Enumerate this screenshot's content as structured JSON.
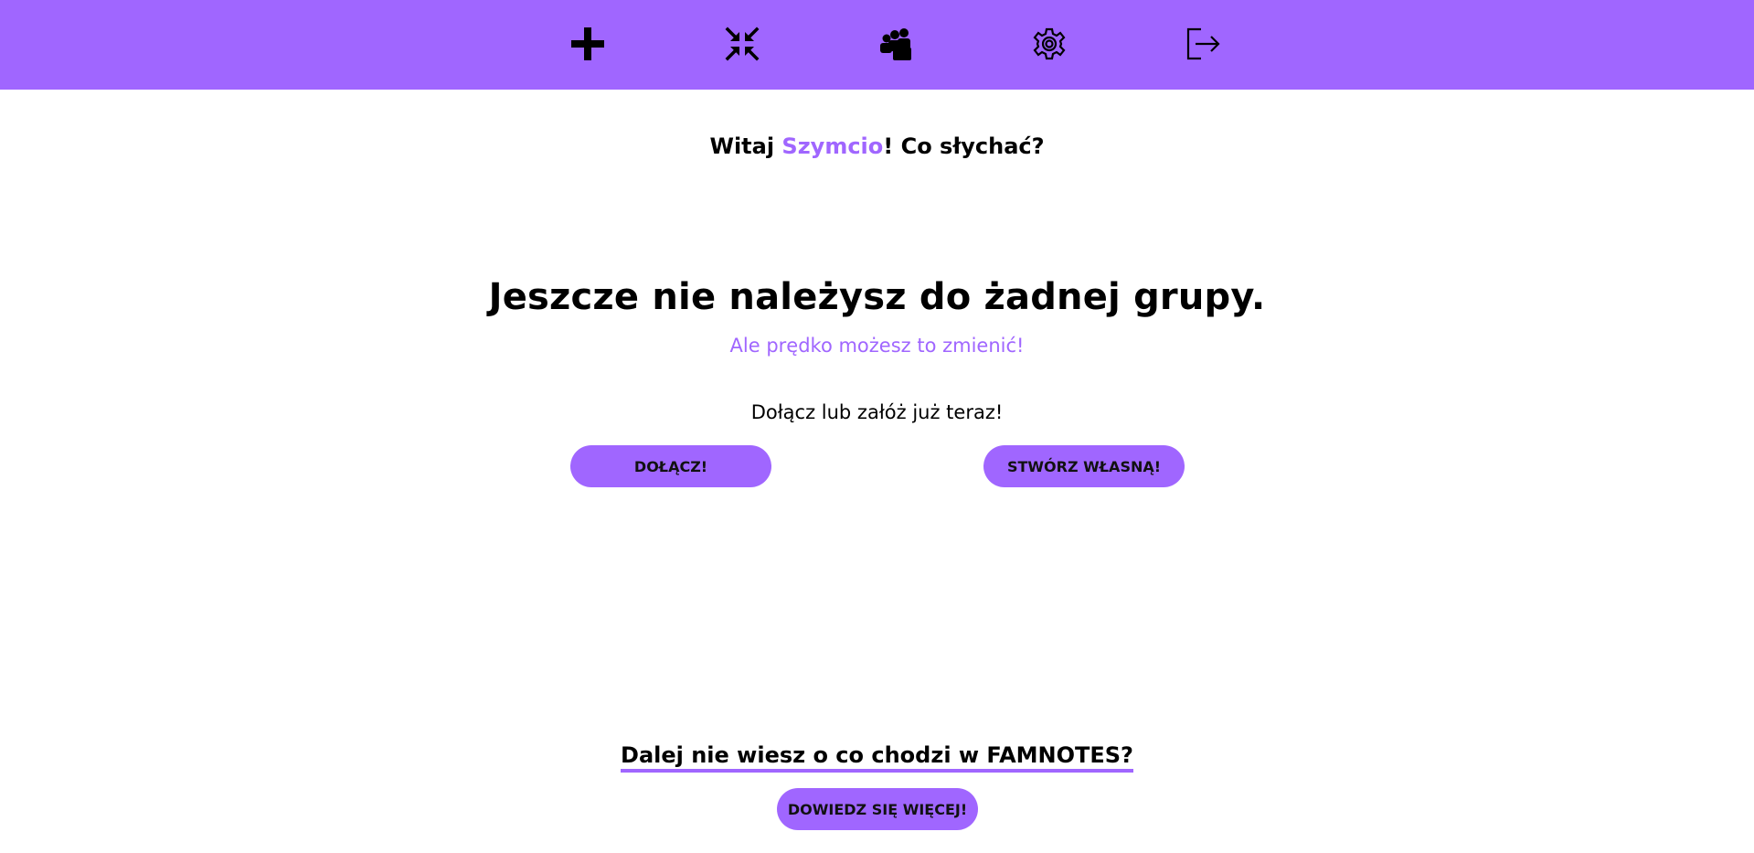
{
  "nav": {
    "icons": [
      "plus-icon",
      "compress-icon",
      "group-icon",
      "settings-icon",
      "logout-icon"
    ]
  },
  "greeting": {
    "prefix": "Witaj ",
    "username": "Szymcio",
    "suffix": "! Co słychać?"
  },
  "main": {
    "headline": "Jeszcze nie należysz do żadnej grupy.",
    "subheadline": "Ale prędko możesz to zmienić!",
    "cta_text": "Dołącz lub załóż już teraz!",
    "join_label": "DOŁĄCZ!",
    "create_label": "STWÓRZ WŁASNĄ!"
  },
  "footer": {
    "question": "Dalej nie wiesz o co chodzi w FAMNOTES?",
    "learn_more_label": "DOWIEDZ SIĘ WIĘCEJ!"
  },
  "colors": {
    "accent": "#a066ff",
    "background": "#ffffff",
    "text": "#000000"
  }
}
